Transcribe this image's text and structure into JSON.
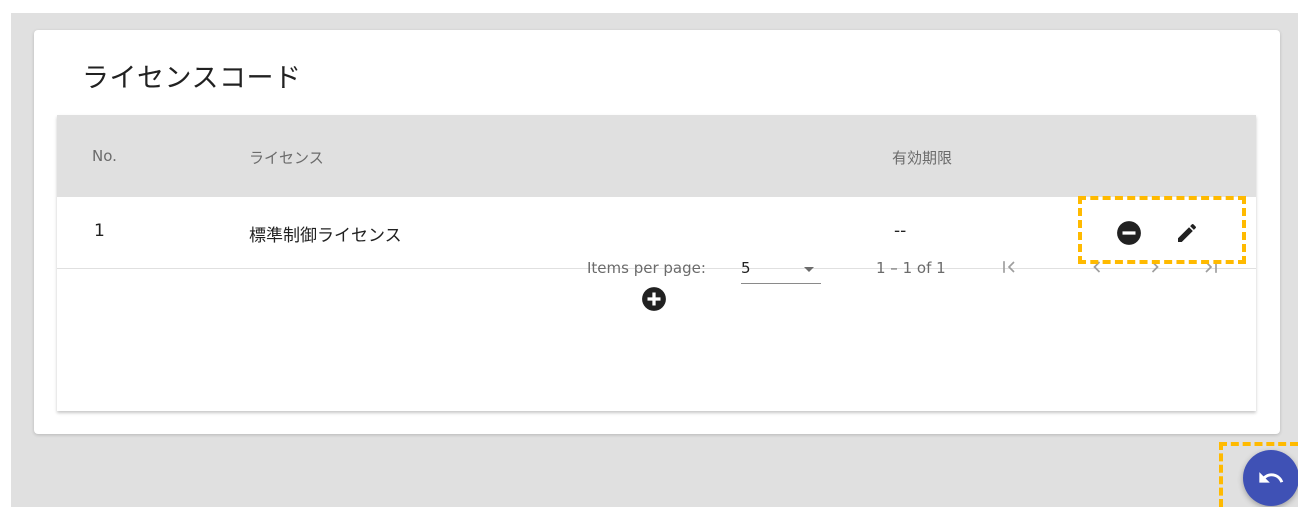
{
  "card": {
    "title": "ライセンスコード"
  },
  "table": {
    "headers": {
      "no": "No.",
      "license": "ライセンス",
      "expiry": "有効期限"
    },
    "rows": [
      {
        "no": "1",
        "license": "標準制御ライセンス",
        "expiry": "--"
      }
    ]
  },
  "paginator": {
    "items_per_page_label": "Items per page:",
    "page_size": "5",
    "range_label": "1 – 1 of 1"
  },
  "icons": {
    "remove": "minus-circle-icon",
    "edit": "pencil-icon",
    "add": "plus-circle-icon",
    "first": "first-page-icon",
    "prev": "chevron-left-icon",
    "next": "chevron-right-icon",
    "last": "last-page-icon",
    "back": "undo-icon"
  },
  "colors": {
    "highlight": "#ffba00",
    "fab": "#3f51b5",
    "header_bg": "#e0e0e0"
  }
}
